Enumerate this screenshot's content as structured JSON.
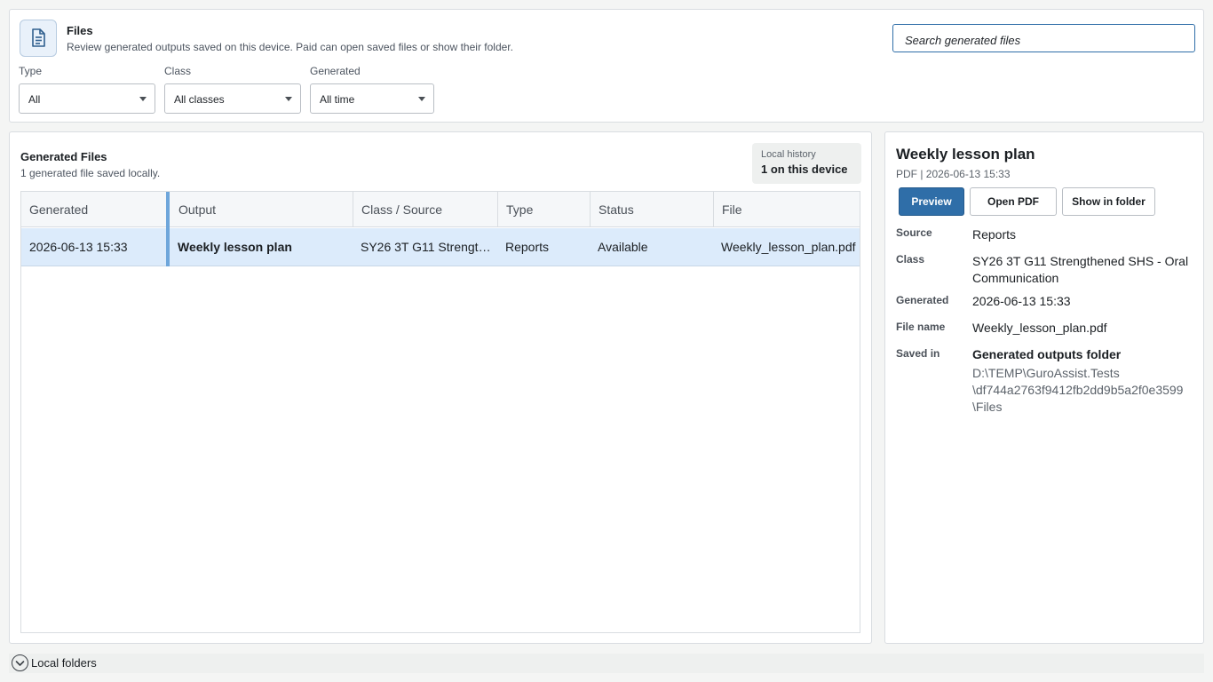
{
  "header": {
    "title": "Files",
    "subtitle": "Review generated outputs saved on this device. Paid can open saved files or show their folder.",
    "search_placeholder": "Search generated files",
    "icon": "document-list-icon"
  },
  "filters": [
    {
      "label": "Type",
      "value": "All"
    },
    {
      "label": "Class",
      "value": "All classes"
    },
    {
      "label": "Generated",
      "value": "All time"
    }
  ],
  "list": {
    "title": "Generated Files",
    "subtitle": "1 generated file saved locally.",
    "history_label": "Local history",
    "history_value": "1 on this device",
    "columns": [
      "Generated",
      "Output",
      "Class / Source",
      "Type",
      "Status",
      "File"
    ],
    "rows": [
      {
        "generated": "2026-06-13 15:33",
        "output": "Weekly lesson plan",
        "class_source": "SY26 3T G11 Strength...",
        "type": "Reports",
        "status": "Available",
        "file": "Weekly_lesson_plan.pdf",
        "selected": true
      }
    ]
  },
  "details": {
    "title": "Weekly lesson plan",
    "meta": "PDF | 2026-06-13 15:33",
    "buttons": {
      "preview": "Preview",
      "open_pdf": "Open PDF",
      "show_folder": "Show in folder"
    },
    "fields": {
      "source_label": "Source",
      "source_value": "Reports",
      "class_label": "Class",
      "class_value_1": "SY26 3T G11 Strengthened SHS - Oral",
      "class_value_2": "Communication",
      "generated_label": "Generated",
      "generated_value": "2026-06-13 15:33",
      "file_name_label": "File name",
      "file_name_value": "Weekly_lesson_plan.pdf",
      "saved_in_label": "Saved in",
      "saved_in_value": "Generated outputs folder",
      "path_1": "D:\\TEMP\\GuroAssist.Tests",
      "path_2": "\\df744a2763f9412fb2dd9b5a2f0e3599",
      "path_3": "\\Files"
    }
  },
  "footer": {
    "label": "Local folders",
    "icon": "chevron-down-circle-icon"
  },
  "colors": {
    "accent": "#2f6ea8",
    "selected_row": "#dcebfb",
    "marker": "#6ea6db"
  }
}
